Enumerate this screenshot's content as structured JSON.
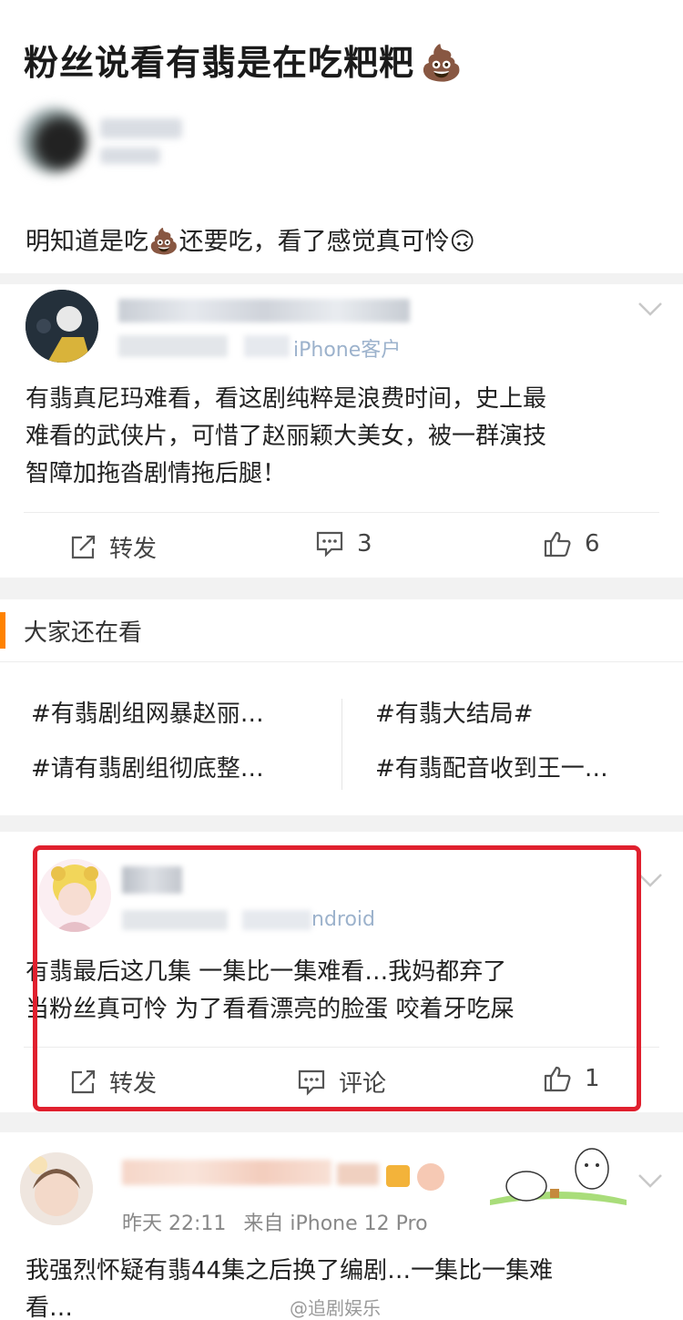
{
  "post": {
    "title": "粉丝说看有翡是在吃粑粑",
    "title_emoji": "💩",
    "body_before": "明知道是吃",
    "body_emoji_1": "💩",
    "body_after": "还要吃，看了感觉真可怜",
    "body_emoji_2": "🙃"
  },
  "comments": [
    {
      "meta_partial": "iPhone客户",
      "text_lines": [
        "有翡真尼玛难看，看这剧纯粹是浪费时间，史上最",
        "难看的武侠片，可惜了赵丽颖大美女，被一群演技",
        "智障加拖沓剧情拖后腿！"
      ],
      "repost_label": "转发",
      "comment_count": "3",
      "like_count": "6"
    },
    {
      "meta_partial": "ndroid",
      "text_lines": [
        "有翡最后这几集 一集比一集难看…我妈都弃了",
        "当粉丝真可怜 为了看看漂亮的脸蛋 咬着牙吃屎"
      ],
      "repost_label": "转发",
      "comment_label": "评论",
      "like_count": "1"
    },
    {
      "time": "昨天 22:11",
      "source": "来自 iPhone 12 Pro",
      "text_lines": [
        "我强烈怀疑有翡44集之后换了编剧…一集比一集难",
        "看…"
      ]
    }
  ],
  "recommend": {
    "title": "大家还在看",
    "topics": [
      "#有翡剧组网暴赵丽…",
      "#有翡大结局#",
      "#请有翡剧组彻底整…",
      "#有翡配音收到王一…"
    ]
  },
  "watermark": "@追剧娱乐",
  "colors": {
    "accent": "#ff8200",
    "highlight_border": "#e0202e",
    "background_gap": "#f2f2f2"
  }
}
